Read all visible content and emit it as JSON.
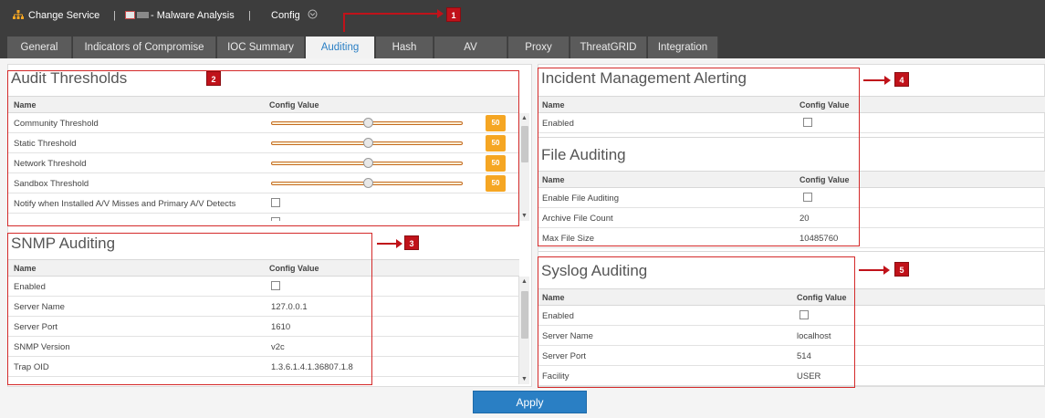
{
  "topbar": {
    "change_service": "Change Service",
    "separator": "|",
    "service_name": "- Malware Analysis",
    "separator2": "|",
    "config": "Config"
  },
  "tabs": [
    {
      "label": "General"
    },
    {
      "label": "Indicators of Compromise"
    },
    {
      "label": "IOC Summary"
    },
    {
      "label": "Auditing",
      "active": true
    },
    {
      "label": "Hash"
    },
    {
      "label": "AV"
    },
    {
      "label": "Proxy"
    },
    {
      "label": "ThreatGRID"
    },
    {
      "label": "Integration"
    }
  ],
  "audit_thresholds": {
    "title": "Audit Thresholds",
    "col_name": "Name",
    "col_value": "Config Value",
    "rows": [
      {
        "name": "Community Threshold",
        "value": "50",
        "level": 0.5
      },
      {
        "name": "Static Threshold",
        "value": "50",
        "level": 0.5
      },
      {
        "name": "Network Threshold",
        "value": "50",
        "level": 0.5
      },
      {
        "name": "Sandbox Threshold",
        "value": "50",
        "level": 0.5
      },
      {
        "name": "Notify when Installed A/V Misses and Primary A/V Detects",
        "checked": false
      }
    ]
  },
  "snmp": {
    "title": "SNMP Auditing",
    "col_name": "Name",
    "col_value": "Config Value",
    "rows": [
      {
        "name": "Enabled",
        "checked": false
      },
      {
        "name": "Server Name",
        "value": "127.0.0.1"
      },
      {
        "name": "Server Port",
        "value": "1610"
      },
      {
        "name": "SNMP Version",
        "value": "v2c"
      },
      {
        "name": "Trap OID",
        "value": "1.3.6.1.4.1.36807.1.8"
      }
    ]
  },
  "incident": {
    "title": "Incident Management Alerting",
    "col_name": "Name",
    "col_value": "Config Value",
    "rows": [
      {
        "name": "Enabled",
        "checked": false
      }
    ]
  },
  "file_auditing": {
    "title": "File Auditing",
    "col_name": "Name",
    "col_value": "Config Value",
    "rows": [
      {
        "name": "Enable File Auditing",
        "checked": false
      },
      {
        "name": "Archive File Count",
        "value": "20"
      },
      {
        "name": "Max File Size",
        "value": "10485760"
      }
    ]
  },
  "syslog": {
    "title": "Syslog Auditing",
    "col_name": "Name",
    "col_value": "Config Value",
    "rows": [
      {
        "name": "Enabled",
        "checked": false
      },
      {
        "name": "Server Name",
        "value": "localhost"
      },
      {
        "name": "Server Port",
        "value": "514"
      },
      {
        "name": "Facility",
        "value": "USER"
      }
    ]
  },
  "callouts": [
    "1",
    "2",
    "3",
    "4",
    "5"
  ],
  "apply_label": "Apply",
  "colors": {
    "accent": "#2a7fc4",
    "badge": "#f5a623",
    "callout": "#c0121a"
  }
}
